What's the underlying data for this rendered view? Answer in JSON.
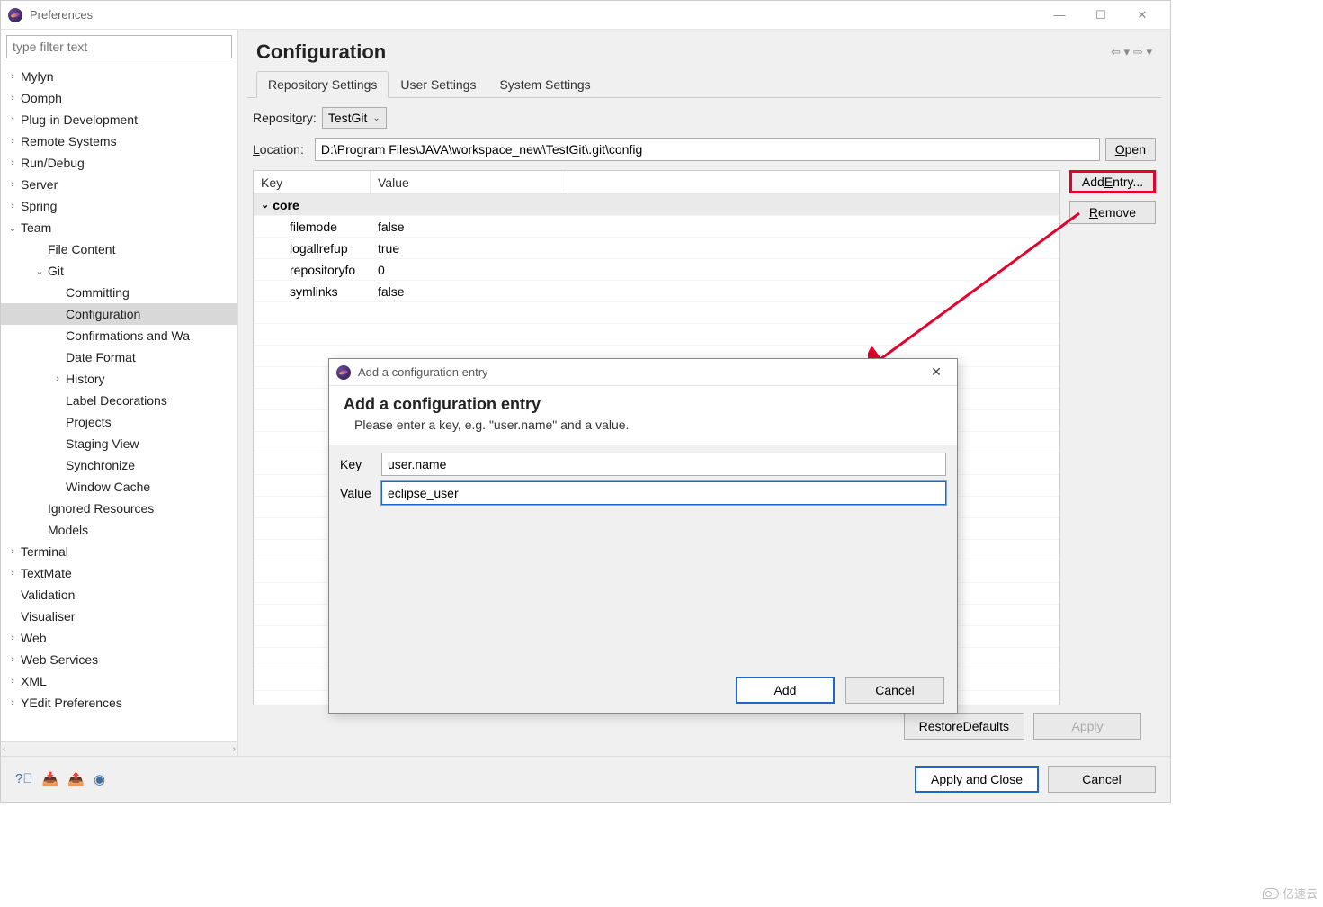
{
  "window": {
    "title": "Preferences"
  },
  "winControls": {
    "min": "—",
    "max": "☐",
    "close": "✕"
  },
  "filter": {
    "placeholder": "type filter text"
  },
  "tree": [
    {
      "label": "Mylyn",
      "level": 0,
      "arrow": "›"
    },
    {
      "label": "Oomph",
      "level": 0,
      "arrow": "›"
    },
    {
      "label": "Plug-in Development",
      "level": 0,
      "arrow": "›"
    },
    {
      "label": "Remote Systems",
      "level": 0,
      "arrow": "›"
    },
    {
      "label": "Run/Debug",
      "level": 0,
      "arrow": "›"
    },
    {
      "label": "Server",
      "level": 0,
      "arrow": "›"
    },
    {
      "label": "Spring",
      "level": 0,
      "arrow": "›"
    },
    {
      "label": "Team",
      "level": 0,
      "arrow": "⌄"
    },
    {
      "label": "File Content",
      "level": 1,
      "arrow": ""
    },
    {
      "label": "Git",
      "level": 1,
      "arrow": "⌄"
    },
    {
      "label": "Committing",
      "level": 2,
      "arrow": ""
    },
    {
      "label": "Configuration",
      "level": 2,
      "arrow": "",
      "selected": true
    },
    {
      "label": "Confirmations and Wa",
      "level": 2,
      "arrow": ""
    },
    {
      "label": "Date Format",
      "level": 2,
      "arrow": ""
    },
    {
      "label": "History",
      "level": 2,
      "arrow": "›"
    },
    {
      "label": "Label Decorations",
      "level": 2,
      "arrow": ""
    },
    {
      "label": "Projects",
      "level": 2,
      "arrow": ""
    },
    {
      "label": "Staging View",
      "level": 2,
      "arrow": ""
    },
    {
      "label": "Synchronize",
      "level": 2,
      "arrow": ""
    },
    {
      "label": "Window Cache",
      "level": 2,
      "arrow": ""
    },
    {
      "label": "Ignored Resources",
      "level": 1,
      "arrow": ""
    },
    {
      "label": "Models",
      "level": 1,
      "arrow": ""
    },
    {
      "label": "Terminal",
      "level": 0,
      "arrow": "›"
    },
    {
      "label": "TextMate",
      "level": 0,
      "arrow": "›"
    },
    {
      "label": "Validation",
      "level": 0,
      "arrow": ""
    },
    {
      "label": "Visualiser",
      "level": 0,
      "arrow": ""
    },
    {
      "label": "Web",
      "level": 0,
      "arrow": "›"
    },
    {
      "label": "Web Services",
      "level": 0,
      "arrow": "›"
    },
    {
      "label": "XML",
      "level": 0,
      "arrow": "›"
    },
    {
      "label": "YEdit Preferences",
      "level": 0,
      "arrow": "›"
    }
  ],
  "page": {
    "title": "Configuration",
    "tabs": [
      "Repository Settings",
      "User Settings",
      "System Settings"
    ],
    "repoLabel": "Repository:",
    "repoValue": "TestGit",
    "locationLabel": "Location:",
    "locationValue": "D:\\Program Files\\JAVA\\workspace_new\\TestGit\\.git\\config",
    "openBtn": "Open",
    "table": {
      "headKey": "Key",
      "headVal": "Value",
      "group": "core",
      "rows": [
        {
          "k": "filemode",
          "v": "false"
        },
        {
          "k": "logallrefup",
          "v": "true"
        },
        {
          "k": "repositoryfo",
          "v": "0"
        },
        {
          "k": "symlinks",
          "v": "false"
        }
      ]
    },
    "addEntry": "Add Entry...",
    "remove": "Remove",
    "restore": "Restore Defaults",
    "apply": "Apply"
  },
  "bottom": {
    "applyClose": "Apply and Close",
    "cancel": "Cancel"
  },
  "dialog": {
    "title": "Add a configuration entry",
    "headTitle": "Add a configuration entry",
    "desc": "Please enter a key, e.g. \"user.name\" and a value.",
    "keyLabel": "Key",
    "keyValue": "user.name",
    "valLabel": "Value",
    "valValue": "eclipse_user",
    "addBtn": "Add",
    "cancelBtn": "Cancel"
  },
  "watermark": "亿速云"
}
